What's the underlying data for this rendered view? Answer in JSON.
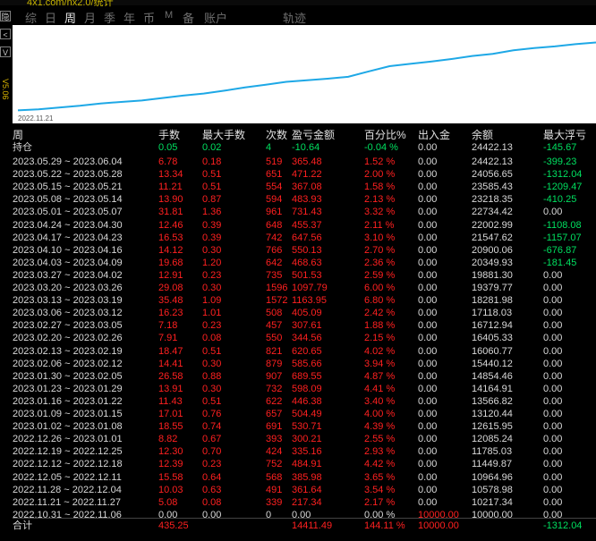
{
  "window_title": "4x1.com/nx2.0/统计",
  "side_buttons": [
    "隐",
    "<",
    "V"
  ],
  "side_label": "V5.06",
  "tabs": [
    "综",
    "日",
    "周",
    "月",
    "季",
    "年",
    "币",
    "M",
    "备",
    "账户",
    "轨迹"
  ],
  "active_tab": "周",
  "chart_start_label": "2022.11.21",
  "chart_data": {
    "type": "line",
    "series": [
      {
        "values": [
          10000.0,
          10217.34,
          10578.98,
          10964.96,
          11449.87,
          11785.03,
          12085.24,
          12615.95,
          13120.44,
          13566.82,
          14164.91,
          14854.46,
          15440.12,
          16060.77,
          16405.33,
          16712.94,
          17118.03,
          18281.98,
          19379.77,
          19881.3,
          20349.93,
          20900.06,
          21547.62,
          22002.99,
          22734.42,
          23218.35,
          23585.43,
          24056.65,
          24422.13
        ]
      }
    ],
    "color": "#1ea8e6"
  },
  "table": {
    "headers": [
      "周",
      "手数",
      "最大手数",
      "次数",
      "盈亏金额",
      "百分比%",
      "出入金",
      "余额",
      "最大浮亏"
    ],
    "holding": {
      "label": "持仓",
      "lots": "0.05",
      "max_lots": "0.02",
      "count": "4",
      "pnl": "-10.64",
      "pct": "-0.04 %",
      "io": "0.00",
      "balance": "24422.13",
      "max_dd": "-145.67"
    },
    "rows": [
      [
        "2023.05.29 ~ 2023.06.04",
        "6.78",
        "0.18",
        "519",
        "365.48",
        "1.52 %",
        "0.00",
        "24422.13",
        "-399.23"
      ],
      [
        "2023.05.22 ~ 2023.05.28",
        "13.34",
        "0.51",
        "651",
        "471.22",
        "2.00 %",
        "0.00",
        "24056.65",
        "-1312.04"
      ],
      [
        "2023.05.15 ~ 2023.05.21",
        "11.21",
        "0.51",
        "554",
        "367.08",
        "1.58 %",
        "0.00",
        "23585.43",
        "-1209.47"
      ],
      [
        "2023.05.08 ~ 2023.05.14",
        "13.90",
        "0.87",
        "594",
        "483.93",
        "2.13 %",
        "0.00",
        "23218.35",
        "-410.25"
      ],
      [
        "2023.05.01 ~ 2023.05.07",
        "31.81",
        "1.36",
        "961",
        "731.43",
        "3.32 %",
        "0.00",
        "22734.42",
        "0.00"
      ],
      [
        "2023.04.24 ~ 2023.04.30",
        "12.46",
        "0.39",
        "648",
        "455.37",
        "2.11 %",
        "0.00",
        "22002.99",
        "-1108.08"
      ],
      [
        "2023.04.17 ~ 2023.04.23",
        "16.53",
        "0.39",
        "742",
        "647.56",
        "3.10 %",
        "0.00",
        "21547.62",
        "-1157.07"
      ],
      [
        "2023.04.10 ~ 2023.04.16",
        "14.12",
        "0.30",
        "766",
        "550.13",
        "2.70 %",
        "0.00",
        "20900.06",
        "-676.87"
      ],
      [
        "2023.04.03 ~ 2023.04.09",
        "19.68",
        "1.20",
        "642",
        "468.63",
        "2.36 %",
        "0.00",
        "20349.93",
        "-181.45"
      ],
      [
        "2023.03.27 ~ 2023.04.02",
        "12.91",
        "0.23",
        "735",
        "501.53",
        "2.59 %",
        "0.00",
        "19881.30",
        "0.00"
      ],
      [
        "2023.03.20 ~ 2023.03.26",
        "29.08",
        "0.30",
        "1596",
        "1097.79",
        "6.00 %",
        "0.00",
        "19379.77",
        "0.00"
      ],
      [
        "2023.03.13 ~ 2023.03.19",
        "35.48",
        "1.09",
        "1572",
        "1163.95",
        "6.80 %",
        "0.00",
        "18281.98",
        "0.00"
      ],
      [
        "2023.03.06 ~ 2023.03.12",
        "16.23",
        "1.01",
        "508",
        "405.09",
        "2.42 %",
        "0.00",
        "17118.03",
        "0.00"
      ],
      [
        "2023.02.27 ~ 2023.03.05",
        "7.18",
        "0.23",
        "457",
        "307.61",
        "1.88 %",
        "0.00",
        "16712.94",
        "0.00"
      ],
      [
        "2023.02.20 ~ 2023.02.26",
        "7.91",
        "0.08",
        "550",
        "344.56",
        "2.15 %",
        "0.00",
        "16405.33",
        "0.00"
      ],
      [
        "2023.02.13 ~ 2023.02.19",
        "18.47",
        "0.51",
        "821",
        "620.65",
        "4.02 %",
        "0.00",
        "16060.77",
        "0.00"
      ],
      [
        "2023.02.06 ~ 2023.02.12",
        "14.41",
        "0.30",
        "879",
        "585.66",
        "3.94 %",
        "0.00",
        "15440.12",
        "0.00"
      ],
      [
        "2023.01.30 ~ 2023.02.05",
        "26.58",
        "0.88",
        "907",
        "689.55",
        "4.87 %",
        "0.00",
        "14854.46",
        "0.00"
      ],
      [
        "2023.01.23 ~ 2023.01.29",
        "13.91",
        "0.30",
        "732",
        "598.09",
        "4.41 %",
        "0.00",
        "14164.91",
        "0.00"
      ],
      [
        "2023.01.16 ~ 2023.01.22",
        "11.43",
        "0.51",
        "622",
        "446.38",
        "3.40 %",
        "0.00",
        "13566.82",
        "0.00"
      ],
      [
        "2023.01.09 ~ 2023.01.15",
        "17.01",
        "0.76",
        "657",
        "504.49",
        "4.00 %",
        "0.00",
        "13120.44",
        "0.00"
      ],
      [
        "2023.01.02 ~ 2023.01.08",
        "18.55",
        "0.74",
        "691",
        "530.71",
        "4.39 %",
        "0.00",
        "12615.95",
        "0.00"
      ],
      [
        "2022.12.26 ~ 2023.01.01",
        "8.82",
        "0.67",
        "393",
        "300.21",
        "2.55 %",
        "0.00",
        "12085.24",
        "0.00"
      ],
      [
        "2022.12.19 ~ 2022.12.25",
        "12.30",
        "0.70",
        "424",
        "335.16",
        "2.93 %",
        "0.00",
        "11785.03",
        "0.00"
      ],
      [
        "2022.12.12 ~ 2022.12.18",
        "12.39",
        "0.23",
        "752",
        "484.91",
        "4.42 %",
        "0.00",
        "11449.87",
        "0.00"
      ],
      [
        "2022.12.05 ~ 2022.12.11",
        "15.58",
        "0.64",
        "568",
        "385.98",
        "3.65 %",
        "0.00",
        "10964.96",
        "0.00"
      ],
      [
        "2022.11.28 ~ 2022.12.04",
        "10.03",
        "0.63",
        "491",
        "361.64",
        "3.54 %",
        "0.00",
        "10578.98",
        "0.00"
      ],
      [
        "2022.11.21 ~ 2022.11.27",
        "5.08",
        "0.08",
        "339",
        "217.34",
        "2.17 %",
        "0.00",
        "10217.34",
        "0.00"
      ],
      [
        "2022.10.31 ~ 2022.11.06",
        "0.00",
        "0.00",
        "0",
        "0.00",
        "0.00 %",
        "10000.00",
        "10000.00",
        "0.00"
      ]
    ],
    "total": {
      "label": "合计",
      "lots": "435.25",
      "max_lots": "",
      "count": "",
      "pnl": "14411.49",
      "pct": "144.11 %",
      "io": "10000.00",
      "balance": "",
      "max_dd": "-1312.04"
    }
  }
}
